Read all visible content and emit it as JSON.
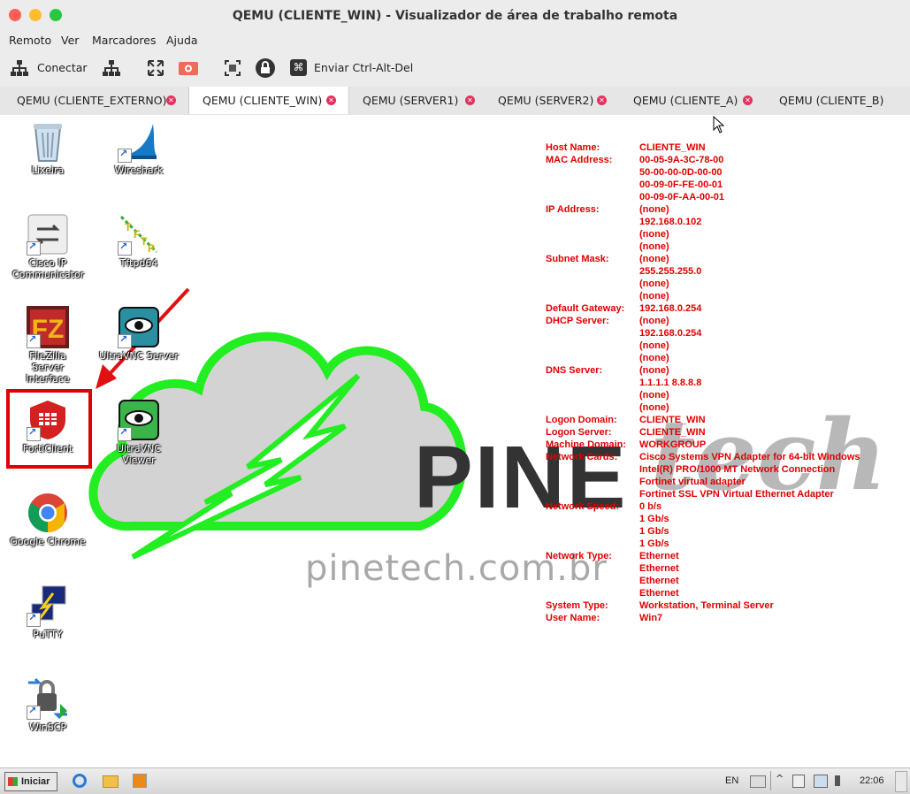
{
  "window": {
    "title": "QEMU (CLIENTE_WIN) - Visualizador de área de trabalho remota"
  },
  "menu": [
    "Remoto",
    "Ver",
    "Marcadores",
    "Ajuda"
  ],
  "toolbar": {
    "connect_label": "Conectar",
    "send_cad_label": "Enviar Ctrl-Alt-Del"
  },
  "tabs": [
    {
      "label": "QEMU (CLIENTE_EXTERNO)"
    },
    {
      "label": "QEMU (CLIENTE_WIN)",
      "active": true
    },
    {
      "label": "QEMU (SERVER1)"
    },
    {
      "label": "QEMU (SERVER2)"
    },
    {
      "label": "QEMU (CLIENTE_A)"
    },
    {
      "label": "QEMU (CLIENTE_B)"
    }
  ],
  "desktop_icons": [
    {
      "label": "Lixeira",
      "icon": "recycle-bin-icon"
    },
    {
      "label": "Wireshark",
      "icon": "wireshark-icon"
    },
    {
      "label": "Cisco IP Communicator",
      "icon": "cisco-ip-communicator-icon"
    },
    {
      "label": "Tftpd64",
      "icon": "tftpd64-icon"
    },
    {
      "label": "FileZilla Server Interface",
      "icon": "filezilla-server-icon"
    },
    {
      "label": "UltraVNC Server",
      "icon": "ultravnc-server-icon"
    },
    {
      "label": "FortiClient",
      "icon": "forticlient-icon"
    },
    {
      "label": "UltraVNC Viewer",
      "icon": "ultravnc-viewer-icon"
    },
    {
      "label": "Google Chrome",
      "icon": "chrome-icon"
    },
    {
      "label": "PuTTY",
      "icon": "putty-icon"
    },
    {
      "label": "WinSCP",
      "icon": "winscp-icon"
    }
  ],
  "wallpaper": {
    "brand": "PINE",
    "brand_script": "tech",
    "url": "pinetech.com.br"
  },
  "bginfo": [
    {
      "k": "Host Name:",
      "v": "CLIENTE_WIN"
    },
    {
      "k": "MAC Address:",
      "v": "00-05-9A-3C-78-00"
    },
    {
      "k": "",
      "v": "50-00-00-0D-00-00"
    },
    {
      "k": "",
      "v": "00-09-0F-FE-00-01"
    },
    {
      "k": "",
      "v": "00-09-0F-AA-00-01"
    },
    {
      "k": "IP Address:",
      "v": "(none)"
    },
    {
      "k": "",
      "v": "192.168.0.102"
    },
    {
      "k": "",
      "v": "(none)"
    },
    {
      "k": "",
      "v": "(none)"
    },
    {
      "k": "Subnet Mask:",
      "v": "(none)"
    },
    {
      "k": "",
      "v": "255.255.255.0"
    },
    {
      "k": "",
      "v": "(none)"
    },
    {
      "k": "",
      "v": "(none)"
    },
    {
      "k": "Default Gateway:",
      "v": "192.168.0.254"
    },
    {
      "k": "DHCP Server:",
      "v": "(none)"
    },
    {
      "k": "",
      "v": "192.168.0.254"
    },
    {
      "k": "",
      "v": "(none)"
    },
    {
      "k": "",
      "v": "(none)"
    },
    {
      "k": "DNS Server:",
      "v": "(none)"
    },
    {
      "k": "",
      "v": "1.1.1.1 8.8.8.8"
    },
    {
      "k": "",
      "v": "(none)"
    },
    {
      "k": "",
      "v": "(none)"
    },
    {
      "k": "Logon Domain:",
      "v": "CLIENTE_WIN"
    },
    {
      "k": "Logon Server:",
      "v": "CLIENTE_WIN"
    },
    {
      "k": "Machine Domain:",
      "v": "WORKGROUP"
    },
    {
      "k": "Network Cards:",
      "v": "Cisco Systems VPN Adapter for 64-bit Windows"
    },
    {
      "k": "",
      "v": "Intel(R) PRO/1000 MT Network Connection"
    },
    {
      "k": "",
      "v": "Fortinet virtual adapter"
    },
    {
      "k": "",
      "v": "Fortinet SSL VPN Virtual Ethernet Adapter"
    },
    {
      "k": "Network Speed:",
      "v": "0 b/s"
    },
    {
      "k": "",
      "v": "1 Gb/s"
    },
    {
      "k": "",
      "v": "1 Gb/s"
    },
    {
      "k": "",
      "v": "1 Gb/s"
    },
    {
      "k": "Network Type:",
      "v": "Ethernet"
    },
    {
      "k": "",
      "v": "Ethernet"
    },
    {
      "k": "",
      "v": "Ethernet"
    },
    {
      "k": "",
      "v": "Ethernet"
    },
    {
      "k": "System Type:",
      "v": "Workstation, Terminal Server"
    },
    {
      "k": "User Name:",
      "v": "Win7"
    }
  ],
  "taskbar": {
    "start_label": "Iniciar",
    "lang": "EN",
    "clock": "22:06"
  },
  "colors": {
    "highlight_box": "#e00000",
    "cloud_outline": "#22ee22",
    "bginfo_text": "#e00000"
  }
}
